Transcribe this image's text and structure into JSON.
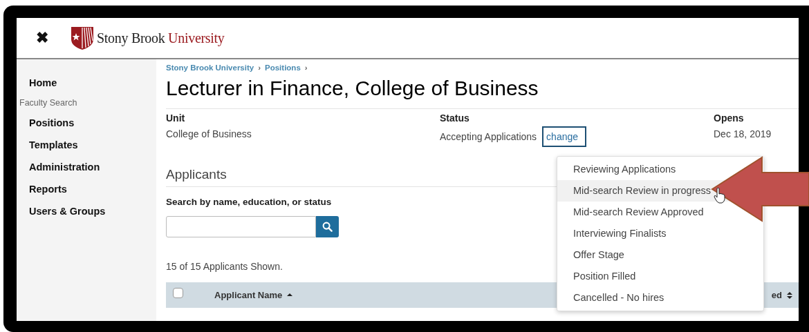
{
  "header": {
    "close_icon": "✖",
    "logo_text": "Stony Brook",
    "logo_accent": "University"
  },
  "sidebar": {
    "items": [
      {
        "label": "Home",
        "kind": "link"
      },
      {
        "label": "Faculty Search",
        "kind": "heading"
      },
      {
        "label": "Positions",
        "kind": "link"
      },
      {
        "label": "Templates",
        "kind": "link"
      },
      {
        "label": "Administration",
        "kind": "link"
      },
      {
        "label": "Reports",
        "kind": "link"
      },
      {
        "label": "Users & Groups",
        "kind": "link"
      }
    ]
  },
  "breadcrumb": [
    "Stony Brook University",
    "Positions"
  ],
  "breadcrumb_separator": "›",
  "title": "Lecturer in Finance, College of Business",
  "details": [
    {
      "label": "Unit",
      "value": "College of Business"
    },
    {
      "label": "Status",
      "value": "Accepting Applications",
      "action": "change"
    },
    {
      "label": "Opens",
      "value": "Dec 18, 2019"
    }
  ],
  "status_menu": [
    {
      "label": "Reviewing Applications",
      "selected": false
    },
    {
      "label": "Mid-search Review in progress",
      "selected": true
    },
    {
      "label": "Mid-search Review Approved",
      "selected": false
    },
    {
      "label": "Interviewing Finalists",
      "selected": false
    },
    {
      "label": "Offer Stage",
      "selected": false
    },
    {
      "label": "Position Filled",
      "selected": false
    },
    {
      "label": "Cancelled - No hires",
      "selected": false
    }
  ],
  "applicants": {
    "heading": "Applicants",
    "search_label": "Search by name, education, or status",
    "count_text": "15 of 15 Applicants Shown.",
    "table": {
      "select_all_checked": false,
      "columns": [
        {
          "label": "Applicant Name",
          "sorted": true
        },
        {
          "label": "ed",
          "sorted": false
        }
      ]
    }
  }
}
